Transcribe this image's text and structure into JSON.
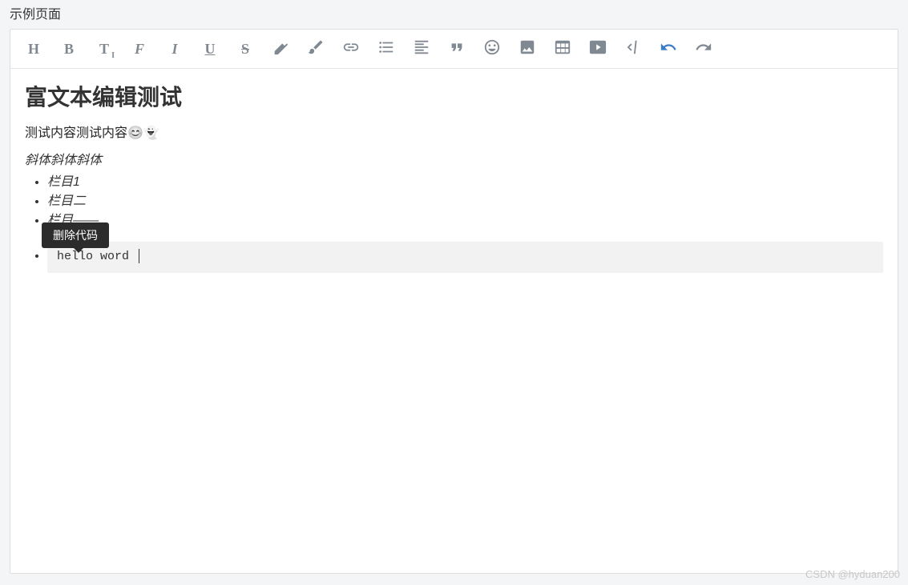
{
  "page_title": "示例页面",
  "toolbar": {
    "heading": "H",
    "bold": "B",
    "fontsize": "T",
    "fontfamily": "F",
    "italic": "I",
    "underline": "U",
    "strike": "S"
  },
  "tooltip": "删除代码",
  "content": {
    "heading": "富文本编辑测试",
    "paragraph": "测试内容测试内容😊👻",
    "italic_line": "斜体斜体斜体",
    "list": [
      "栏目1",
      "栏目二",
      "栏目——"
    ],
    "code": "hello word "
  },
  "watermark": "CSDN @hyduan200"
}
